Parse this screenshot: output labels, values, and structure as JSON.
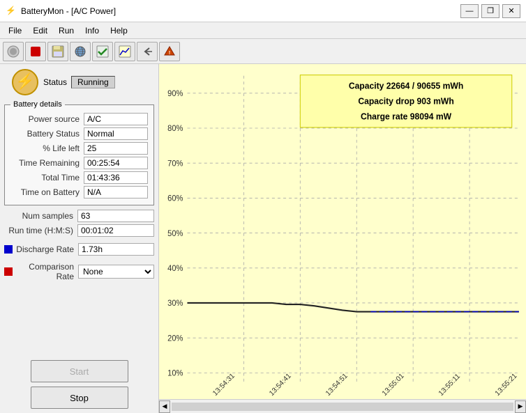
{
  "window": {
    "title": "BatteryMon - [A/C Power]",
    "icon": "⚡"
  },
  "title_controls": {
    "minimize": "—",
    "restore": "❐",
    "close": "✕"
  },
  "menu": {
    "items": [
      "File",
      "Edit",
      "Run",
      "Info",
      "Help"
    ]
  },
  "toolbar": {
    "buttons": [
      "⚙",
      "⏹",
      "💾",
      "🌐",
      "✔",
      "📈",
      "↩",
      "⛔"
    ]
  },
  "status": {
    "label": "Status",
    "value": "Running"
  },
  "battery_details": {
    "group_label": "Battery details",
    "fields": [
      {
        "label": "Power source",
        "value": "A/C"
      },
      {
        "label": "Battery Status",
        "value": "Normal"
      },
      {
        "label": "% Life left",
        "value": "25"
      },
      {
        "label": "Time Remaining",
        "value": "00:25:54"
      },
      {
        "label": "Total Time",
        "value": "01:43:36"
      },
      {
        "label": "Time on Battery",
        "value": "N/A"
      }
    ]
  },
  "samples": {
    "num_samples_label": "Num samples",
    "num_samples_value": "63",
    "run_time_label": "Run time (H:M:S)",
    "run_time_value": "00:01:02"
  },
  "discharge_rate": {
    "label": "Discharge Rate",
    "value": "1.73h",
    "color": "#0000cc"
  },
  "comparison_rate": {
    "label": "Comparison Rate",
    "value": "None",
    "color": "#cc0000",
    "options": [
      "None"
    ]
  },
  "buttons": {
    "start_label": "Start",
    "stop_label": "Stop"
  },
  "chart": {
    "info_capacity": "Capacity 22664 / 90655 mWh",
    "info_drop": "Capacity drop 903 mWh",
    "info_charge": "Charge rate 98094 mW",
    "y_labels": [
      "90%",
      "80%",
      "70%",
      "60%",
      "50%",
      "40%",
      "30%",
      "20%",
      "10%"
    ],
    "x_labels": [
      "13:54:31",
      "13:54:41",
      "13:54:51",
      "13:55:01",
      "13:55:11",
      "13:55:21"
    ],
    "scroll_left": "◀",
    "scroll_right": "▶"
  }
}
